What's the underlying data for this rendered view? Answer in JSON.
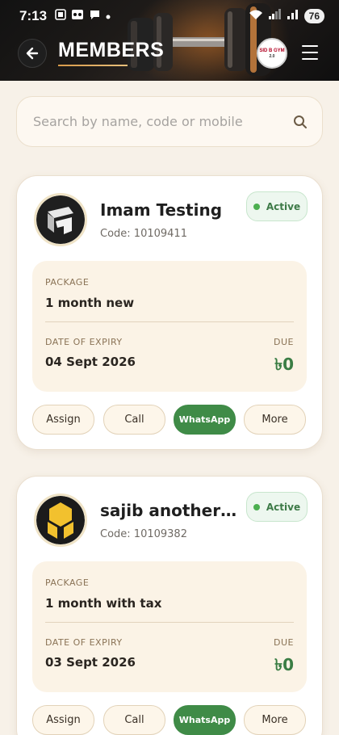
{
  "status_bar": {
    "time": "7:13",
    "battery": "76"
  },
  "header": {
    "title": "MEMBERS",
    "logo_line1": "SID B GYM",
    "logo_line2": "2.0"
  },
  "search": {
    "placeholder": "Search by name, code or mobile"
  },
  "labels": {
    "package": "PACKAGE",
    "date_of_expiry": "DATE OF EXPIRY",
    "due": "DUE",
    "assign": "Assign",
    "call": "Call",
    "whatsapp": "WhatsApp",
    "more": "More"
  },
  "members": [
    {
      "name": "Imam Testing",
      "code": "Code: 10109411",
      "status": "Active",
      "package": "1 month new",
      "expiry": "04 Sept 2026",
      "due": "৳0"
    },
    {
      "name": "sajib another tes...",
      "code": "Code: 10109382",
      "status": "Active",
      "package": "1 month with tax",
      "expiry": "03 Sept 2026",
      "due": "৳0"
    }
  ],
  "colors": {
    "accent_green": "#3f8b47",
    "active_dot": "#4caf50",
    "card_bg": "#ffffff",
    "info_box_bg": "#fbf3e6",
    "page_bg": "#f7f1e8"
  },
  "icons": [
    "back-arrow-icon",
    "hamburger-menu-icon",
    "search-icon",
    "status-dot-icon",
    "wifi-icon",
    "signal-icon"
  ]
}
